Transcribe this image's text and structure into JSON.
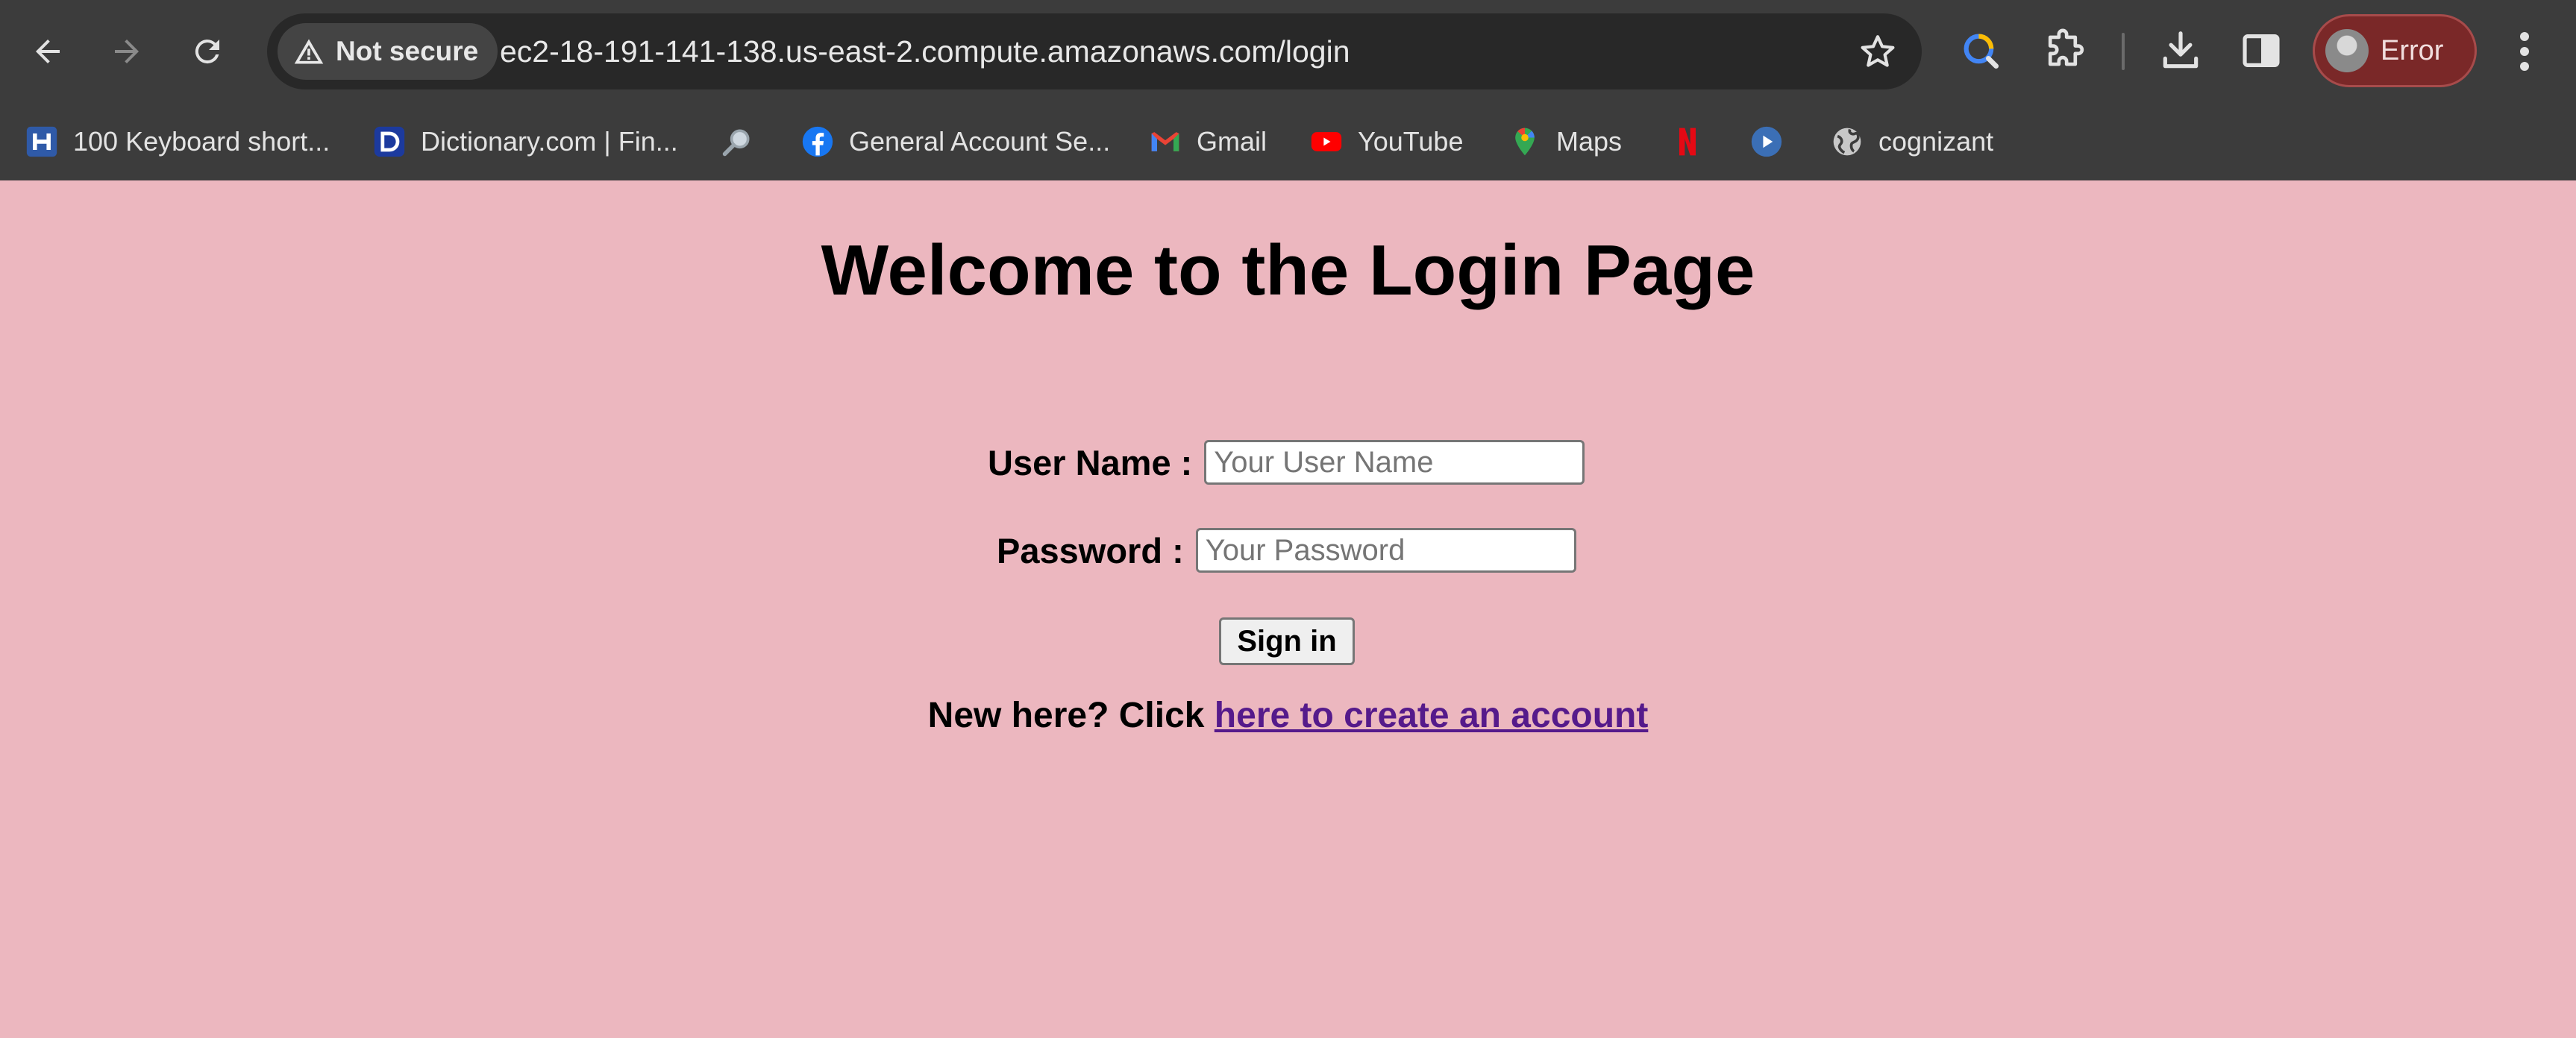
{
  "browser": {
    "security_chip": "Not secure",
    "url": "ec2-18-191-141-138.us-east-2.compute.amazonaws.com/login",
    "profile_label": "Error",
    "colors": {
      "chrome": "#3c3c3c",
      "omnibox": "#282828",
      "profile": "#7a2828"
    }
  },
  "bookmarks": [
    {
      "label": "100 Keyboard short...",
      "icon": "h-logo-icon"
    },
    {
      "label": "Dictionary.com | Fin...",
      "icon": "dictionary-icon"
    },
    {
      "label": "",
      "icon": "magnifier-icon"
    },
    {
      "label": "General Account Se...",
      "icon": "facebook-icon"
    },
    {
      "label": "Gmail",
      "icon": "gmail-icon"
    },
    {
      "label": "YouTube",
      "icon": "youtube-icon"
    },
    {
      "label": "Maps",
      "icon": "maps-icon"
    },
    {
      "label": "",
      "icon": "netflix-icon"
    },
    {
      "label": "",
      "icon": "play-icon"
    },
    {
      "label": "cognizant",
      "icon": "globe-icon"
    }
  ],
  "page": {
    "title": "Welcome to the Login Page",
    "username_label": "User Name :",
    "username_placeholder": "Your User Name",
    "username_value": "",
    "password_label": "Password :",
    "password_placeholder": "Your Password",
    "password_value": "",
    "signin_label": "Sign in",
    "new_here_text": "New here? Click ",
    "create_account_link": "here to create an account",
    "colors": {
      "background": "#ecb7bf",
      "link": "#551a8b"
    }
  }
}
